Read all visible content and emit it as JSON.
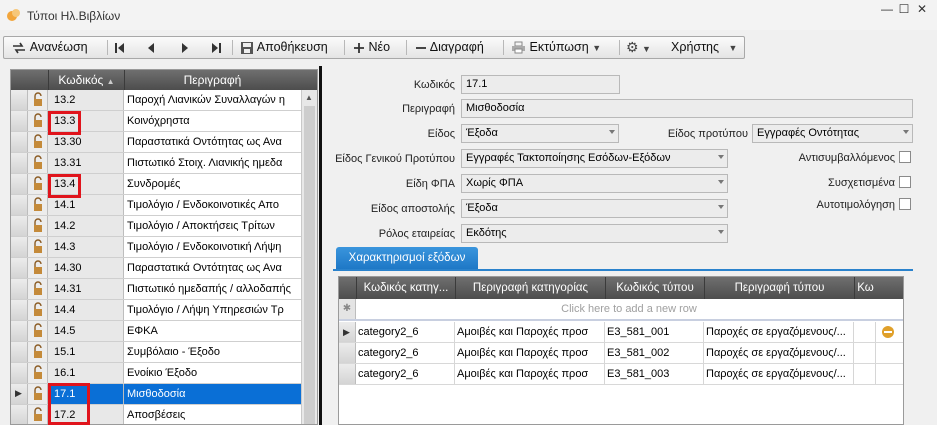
{
  "window": {
    "title": "Τύποι Ηλ.Βιβλίων",
    "min": "—",
    "max": "☐",
    "close": "✕"
  },
  "toolbar": {
    "refresh": "Ανανέωση",
    "save": "Αποθήκευση",
    "new": "Νέο",
    "delete": "Διαγραφή",
    "print": "Εκτύπωση",
    "user": "Χρήστης"
  },
  "list": {
    "col_code": "Κωδικός",
    "col_desc": "Περιγραφή",
    "rows": [
      {
        "code": "13.2",
        "desc": "Παροχή Λιανικών Συναλλαγών η"
      },
      {
        "code": "13.3",
        "desc": "Κοινόχρηστα"
      },
      {
        "code": "13.30",
        "desc": "Παραστατικά Οντότητας ως Ανα"
      },
      {
        "code": "13.31",
        "desc": "Πιστωτικό Στοιχ. Λιανικής ημεδα"
      },
      {
        "code": "13.4",
        "desc": "Συνδρομές"
      },
      {
        "code": "14.1",
        "desc": "Τιμολόγιο / Ενδοκοινοτικές Απο"
      },
      {
        "code": "14.2",
        "desc": "Τιμολόγιο / Αποκτήσεις Τρίτων"
      },
      {
        "code": "14.3",
        "desc": "Τιμολόγιο / Ενδοκοινοτική Λήψη"
      },
      {
        "code": "14.30",
        "desc": "Παραστατικά Οντότητας ως  Ανα"
      },
      {
        "code": "14.31",
        "desc": "Πιστωτικό ημεδαπής / αλλοδαπής"
      },
      {
        "code": "14.4",
        "desc": "Τιμολόγιο / Λήψη Υπηρεσιών Τρ"
      },
      {
        "code": "14.5",
        "desc": "ΕΦΚΑ"
      },
      {
        "code": "15.1",
        "desc": "Συμβόλαιο - Έξοδο"
      },
      {
        "code": "16.1",
        "desc": "Ενοίκιο Έξοδο"
      },
      {
        "code": "17.1",
        "desc": "Μισθοδοσία"
      },
      {
        "code": "17.2",
        "desc": "Αποσβέσεις"
      }
    ]
  },
  "form": {
    "code_label": "Κωδικός",
    "code": "17.1",
    "desc_label": "Περιγραφή",
    "desc": "Μισθοδοσία",
    "kind_label": "Είδος",
    "kind": "Έξοδα",
    "proto_kind_label": "Είδος προτύπου",
    "proto_kind": "Εγγραφές Οντότητας",
    "std_kind_label": "Είδος Γενικού Προτύπου",
    "std_kind": "Εγγραφές Τακτοποίησης Εσόδων-Εξόδων",
    "vat_label": "Είδη ΦΠΑ",
    "vat": "Χωρίς ΦΠΑ",
    "send_label": "Είδος αποστολής",
    "send": "Έξοδα",
    "role_label": "Ρόλος εταιρείας",
    "role": "Εκδότης",
    "cb1": "Αντισυμβαλλόμενος",
    "cb2": "Συσχετισμένα",
    "cb3": "Αυτοτιμολόγηση"
  },
  "tab": {
    "label": "Χαρακτηρισμοί εξόδων"
  },
  "grid": {
    "col1": "Κωδικός κατηγ...",
    "col2": "Περιγραφή κατηγορίας",
    "col3": "Κωδικός τύπου",
    "col4": "Περιγραφή τύπου",
    "col5": "Κω",
    "new_row": "Click here to add a new row",
    "rows": [
      {
        "c1": "category2_6",
        "c2": "Αμοιβές και Παροχές προσ",
        "c3": "E3_581_001",
        "c4": "Παροχές σε εργαζόμενους/..."
      },
      {
        "c1": "category2_6",
        "c2": "Αμοιβές και Παροχές προσ",
        "c3": "E3_581_002",
        "c4": "Παροχές σε εργαζόμενους/..."
      },
      {
        "c1": "category2_6",
        "c2": "Αμοιβές και Παροχές προσ",
        "c3": "E3_581_003",
        "c4": "Παροχές σε εργαζόμενους/..."
      }
    ]
  }
}
